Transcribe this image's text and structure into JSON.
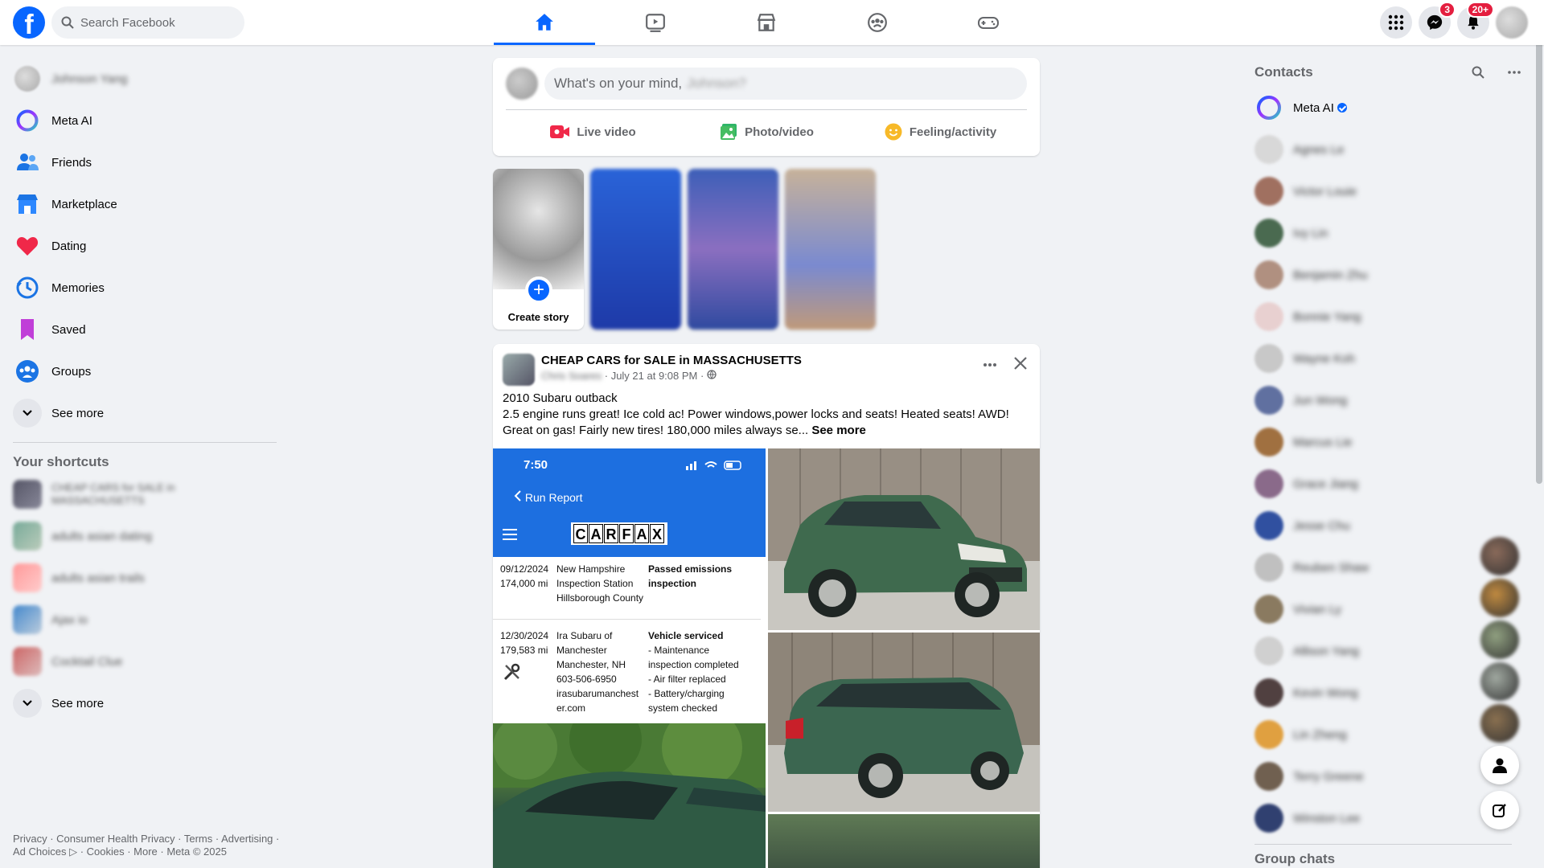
{
  "header": {
    "search_placeholder": "Search Facebook",
    "messenger_badge": "3",
    "notifications_badge": "20+"
  },
  "left_nav": {
    "profile_name": "Johnson Yang",
    "items": [
      "Meta AI",
      "Friends",
      "Marketplace",
      "Dating",
      "Memories",
      "Saved",
      "Groups"
    ],
    "see_more": "See more",
    "shortcuts_title": "Your shortcuts",
    "shortcuts": [
      "CHEAP CARS for SALE in MASSACHUSETTS",
      "adults asian dating",
      "adults asian trails",
      "Ajax io",
      "Cocktail Clue"
    ],
    "shortcuts_see_more": "See more"
  },
  "footer": {
    "line1": "Privacy · Consumer Health Privacy · Terms · Advertising ·",
    "line2": "Ad Choices ▷ · Cookies · More · Meta © 2025"
  },
  "composer": {
    "prompt": "What's on your mind,",
    "name_blur": "Johnson?",
    "live": "Live video",
    "photo": "Photo/video",
    "feeling": "Feeling/activity"
  },
  "stories": {
    "create_label": "Create story"
  },
  "post": {
    "group_name": "CHEAP CARS for SALE in MASSACHUSETTS",
    "author_blur": "Chris Soares",
    "meta": " · July 21 at 9:08 PM · ",
    "title_line": "2010 Subaru outback",
    "body": "2.5 engine runs great! Ice cold ac! Power windows,power locks and seats! Heated seats! AWD! Great on gas! Fairly new tires! 180,000 miles always se...",
    "see_more": " See more",
    "carfax": {
      "time": "7:50",
      "run_report": "Run Report",
      "logo": [
        "C",
        "A",
        "R",
        "F",
        "A",
        "X"
      ],
      "rec1_date": "09/12/2024",
      "rec1_miles": "174,000 mi",
      "rec1_place": [
        "New Hampshire",
        "Inspection Station",
        "Hillsborough County"
      ],
      "rec1_event": [
        "Passed emissions",
        "inspection"
      ],
      "rec2_date": "12/30/2024",
      "rec2_miles": "179,583 mi",
      "rec2_place": [
        "Ira Subaru of",
        "Manchester",
        "Manchester, NH",
        "603-506-6950",
        "irasubarumanchest",
        "er.com"
      ],
      "rec2_event_title": "Vehicle serviced",
      "rec2_event": [
        "- Maintenance",
        "  inspection completed",
        "- Air filter replaced",
        "- Battery/charging",
        "  system checked"
      ]
    }
  },
  "contacts": {
    "title": "Contacts",
    "meta_ai": "Meta AI",
    "names": [
      "Agnes Le",
      "Victor Louie",
      "Ivy Lin",
      "Benjamin Zhu",
      "Bonnie Yang",
      "Wayne Koh",
      "Jun Wong",
      "Marcus Lie",
      "Grace Jiang",
      "Jesse Chu",
      "Reuben Shaw",
      "Vivian Ly",
      "Allison Yang",
      "Kevin Wong",
      "Lin Zheng",
      "Terry Greene",
      "Winston Lee"
    ],
    "avatar_colors": [
      "#d8d8d8",
      "#a07060",
      "#4a6a50",
      "#b09080",
      "#e8d0d0",
      "#c8c8c8",
      "#6070a0",
      "#a07040",
      "#8a6a8a",
      "#3050a0",
      "#c0c0c0",
      "#8a7a60",
      "#d0d0d0",
      "#504040",
      "#e0a040",
      "#706050",
      "#304070"
    ],
    "group_chats": "Group chats"
  },
  "floating": {
    "avatar_colors": [
      "#8a6a5a",
      "#c08a40",
      "#90a080",
      "#a0a8a0",
      "#8a7050"
    ]
  }
}
